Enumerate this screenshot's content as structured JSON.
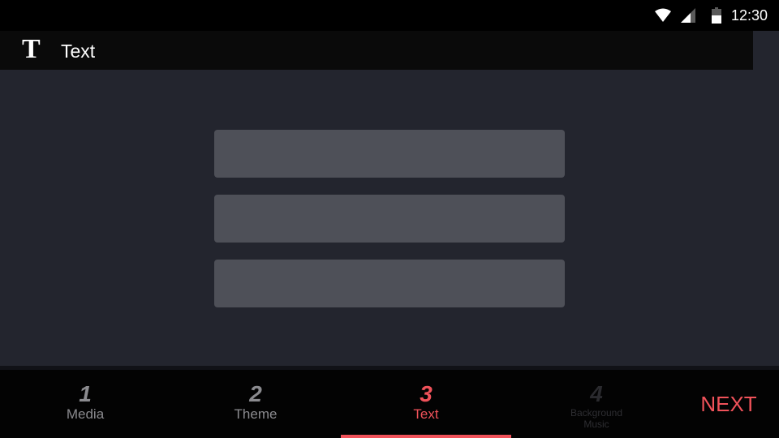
{
  "status_bar": {
    "time": "12:30"
  },
  "app_bar": {
    "icon_glyph": "T",
    "icon_name": "text-format-icon",
    "title": "Text"
  },
  "text_fields": [
    {
      "value": "",
      "placeholder": ""
    },
    {
      "value": "",
      "placeholder": ""
    },
    {
      "value": "",
      "placeholder": ""
    }
  ],
  "steps": [
    {
      "number": "1",
      "label": "Media",
      "state": "completed"
    },
    {
      "number": "2",
      "label": "Theme",
      "state": "completed"
    },
    {
      "number": "3",
      "label": "Text",
      "state": "active"
    },
    {
      "number": "4",
      "label": "Background Music",
      "state": "disabled"
    }
  ],
  "next_label": "NEXT",
  "colors": {
    "accent": "#f0525a",
    "content_bg": "#23252e",
    "field_bg": "#4e5058",
    "inactive": "#8b8b8f"
  }
}
